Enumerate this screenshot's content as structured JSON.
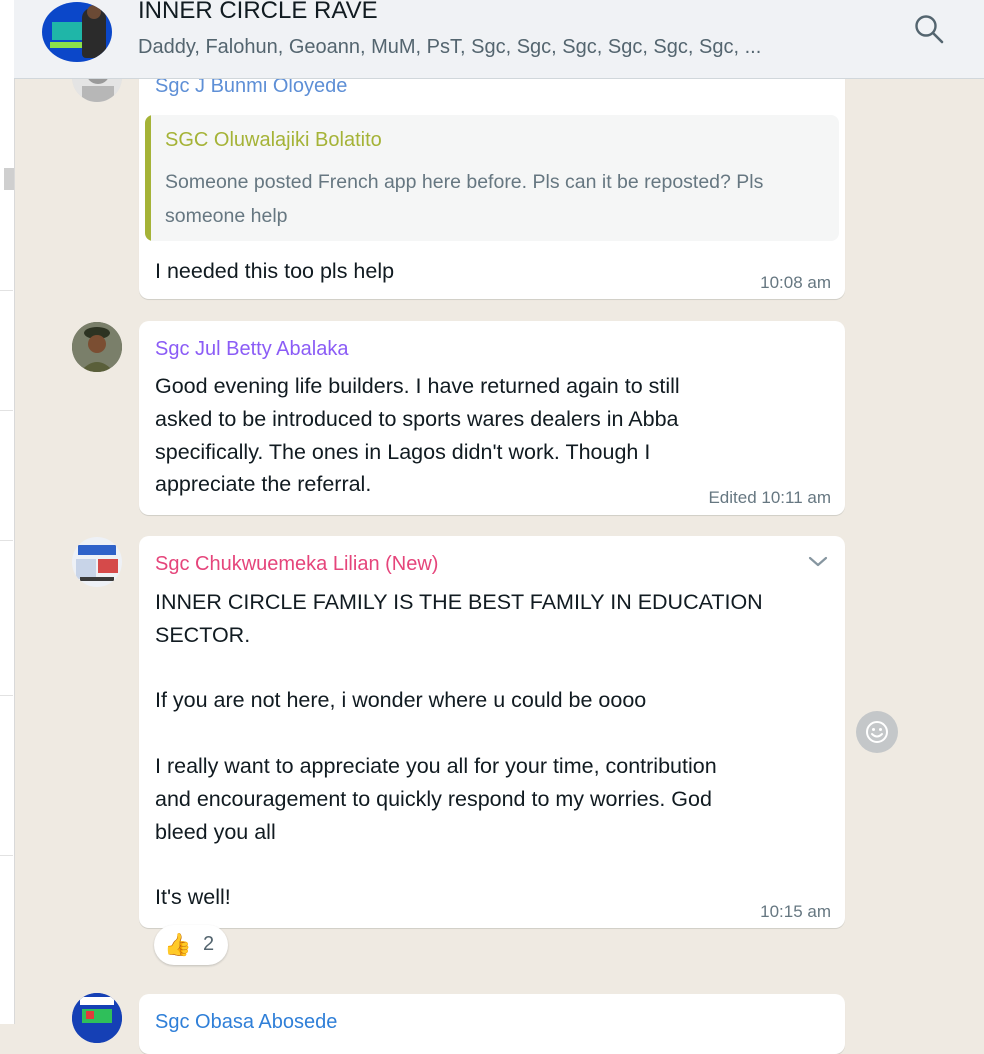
{
  "colors": {
    "chat_bg": "#efeae2",
    "bubble_bg": "#ffffff",
    "header_bg": "#f0f2f5",
    "sender_bunmi": "#5e8fd6",
    "sender_betty": "#8b5cf6",
    "sender_lilian": "#e5457b",
    "sender_obasa": "#2f7fd8",
    "quote_accent": "#a5b337",
    "timestamp": "#667781"
  },
  "header": {
    "title": "INNER CIRCLE RAVE",
    "members": "Daddy, Falohun, Geoann, MuM, PsT, Sgc, Sgc, Sgc, Sgc, Sgc, Sgc, ...",
    "search_icon": "search-icon"
  },
  "messages": [
    {
      "sender": "Sgc J Bunmi Oloyede",
      "quote": {
        "sender": "SGC Oluwalajiki Bolatito",
        "text": "Someone posted French app here before. Pls can it be reposted? Pls someone help"
      },
      "text": "I needed this too pls help",
      "time": "10:08 am"
    },
    {
      "sender": "Sgc Jul Betty Abalaka",
      "text": "Good evening life builders. I have returned again to still\nasked to be introduced to sports wares dealers in Abba\nspecifically. The ones in Lagos didn't work. Though I\nappreciate the referral.",
      "time": "Edited 10:11 am"
    },
    {
      "sender": "Sgc Chukwuemeka Lilian (New)",
      "text": "INNER CIRCLE FAMILY IS THE BEST FAMILY IN EDUCATION\nSECTOR.\n\nIf you are not here, i wonder where u could be oooo\n\nI really want to appreciate you all for your time, contribution\nand encouragement to quickly respond to my worries. God\nbleed you all\n\nIt's well!",
      "time": "10:15 am",
      "reaction": {
        "emoji": "👍",
        "count": "2"
      }
    },
    {
      "sender": "Sgc Obasa Abosede"
    }
  ]
}
